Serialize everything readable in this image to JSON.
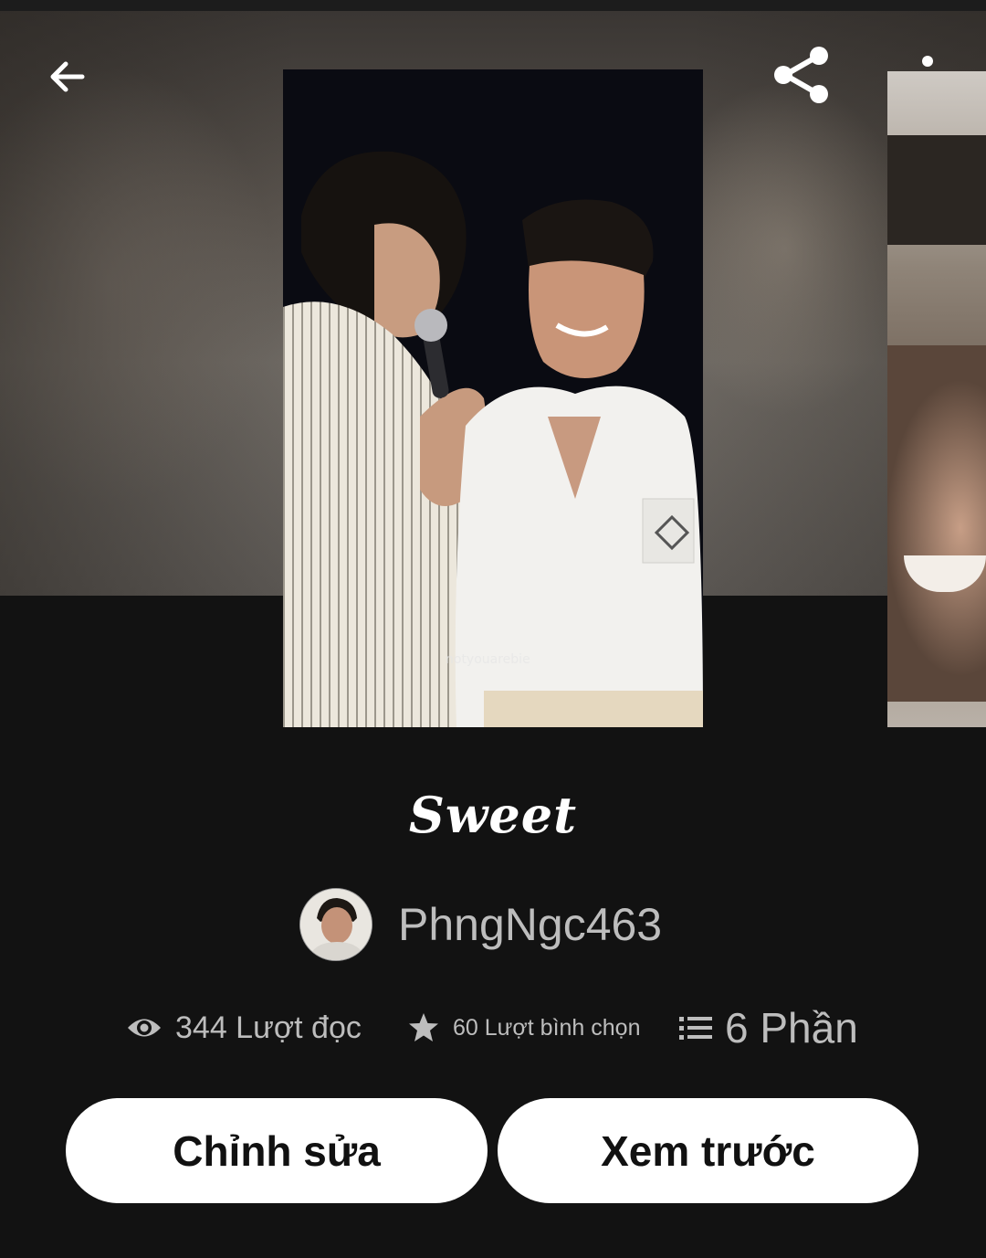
{
  "header": {
    "back_icon": "arrow-left-icon",
    "share_icon": "share-icon",
    "more_icon": "more-vertical-icon"
  },
  "cover": {
    "watermark": "notyouarebie"
  },
  "story": {
    "title": "Sweet",
    "author": "PhngNgc463"
  },
  "stats": {
    "reads": "344 Lượt đọc",
    "votes": "60 Lượt bình chọn",
    "parts": "6 Phần"
  },
  "actions": {
    "edit_label": "Chỉnh sửa",
    "preview_label": "Xem trước"
  },
  "colors": {
    "background": "#121212",
    "button_bg": "#ffffff",
    "muted_text": "#bdbdbd"
  }
}
